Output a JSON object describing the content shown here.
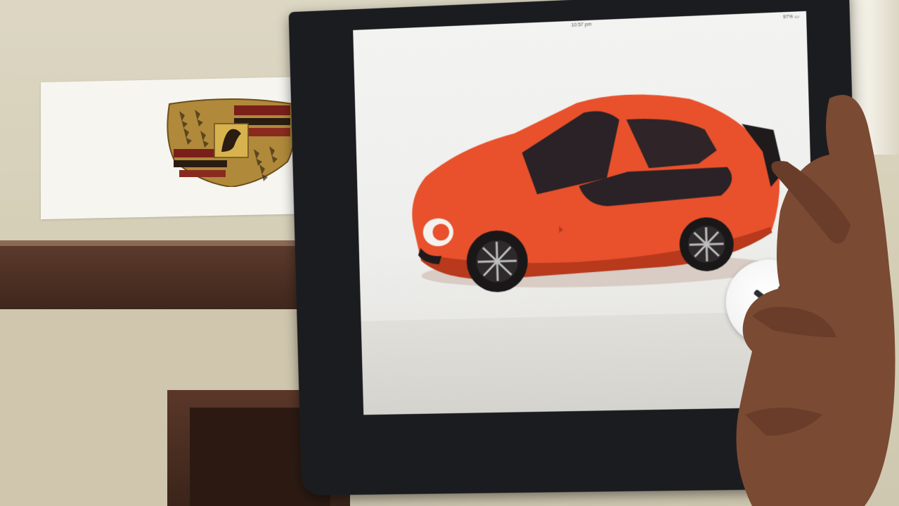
{
  "photo": {
    "colors": {
      "car_body": "#e8512c",
      "car_shadow": "#b8391c",
      "wall": "#dcd7c3",
      "shelf": "#4a2e22",
      "tablet_bezel": "#1b1c20",
      "screen_bg": "#f0f0ee"
    }
  },
  "tablet": {
    "status_bar": {
      "carrier": "",
      "time": "10:57 pm",
      "battery": "97% ▭"
    },
    "ar_model": "car-3d-model",
    "tool_button_icon": "wrench-screwdriver-icon"
  },
  "poster": {
    "icon": "crest-emblem-icon"
  }
}
